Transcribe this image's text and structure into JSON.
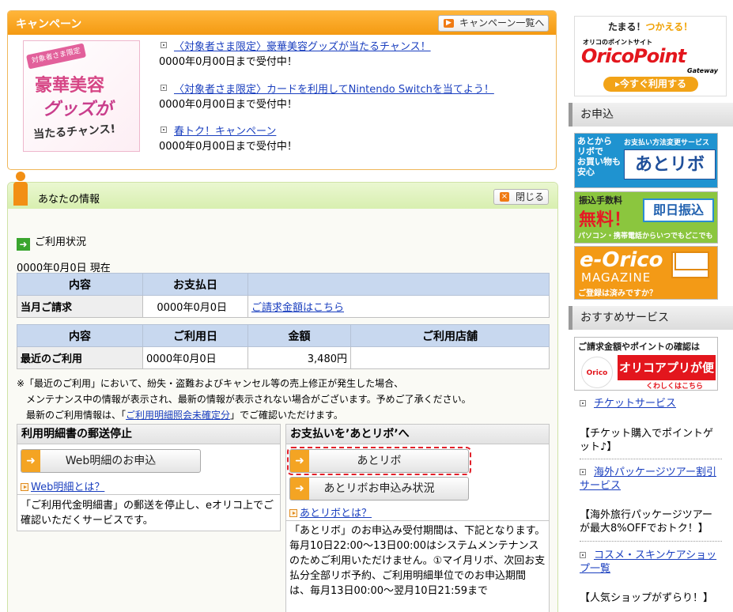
{
  "campaign": {
    "title": "キャンペーン",
    "all_button": "キャンペーン一覧へ",
    "banner": {
      "tag": "対象者さま限定",
      "line1": "豪華美容",
      "line2": "グッズが",
      "line3": "当たるチャンス!"
    },
    "items": [
      {
        "label": "〈対象者さま限定〉豪華美容グッズが当たるチャンス！",
        "date": "0000年0月00日まで受付中！"
      },
      {
        "label": "〈対象者さま限定〉カードを利用してNintendo Switchを当てよう！",
        "date": "0000年0月00日まで受付中！"
      },
      {
        "label": "春トク！キャンペーン",
        "date": "0000年0月00日まで受付中！"
      }
    ]
  },
  "info": {
    "title": "あなたの情報",
    "close": "閉じる",
    "usage_heading": "ご利用状況",
    "as_of": "0000年0月0日 現在",
    "table1": {
      "headers": [
        "内容",
        "お支払日",
        ""
      ],
      "row": {
        "label": "当月ご請求",
        "date": "0000年0月0日",
        "link": "ご請求金額はこちら"
      }
    },
    "table2": {
      "headers": [
        "内容",
        "ご利用日",
        "金額",
        "ご利用店舗"
      ],
      "row": {
        "label": "最近のご利用",
        "date": "0000年0月0日",
        "amount": "3,480円",
        "store": ""
      }
    },
    "note": {
      "line1": "※「最近のご利用」において、紛失・盗難およびキャンセル等の売上修正が発生した場合、",
      "line2": "メンテナンス中の情報が表示され、最新の情報が表示されない場合がございます。予めご了承ください。",
      "line3_pre": "最新のご利用情報は、「",
      "line3_link": "ご利用明細照会未確定分",
      "line3_post": "」でご確認いただけます。"
    },
    "box1": {
      "title": "利用明細書の郵送停止",
      "button": "Web明細のお申込",
      "link": "Web明細とは？",
      "text": "「ご利用代金明細書」の郵送を停止し、eオリコ上でご確認いただくサービスです。"
    },
    "box2": {
      "title": "お支払いを’あとリボ’へ",
      "button1": "あとリボ",
      "button2": "あとリボお申込み状況",
      "link": "あとリボとは？",
      "text": "「あとリボ」のお申込み受付期間は、下記となります。毎月10日22:00～13日00:00はシステムメンテナンスのためご利用いただけません。①マイ月リボ、次回お支払分全部リボ予約、ご利用明細単位でのお申込期間は、毎月13日00:00～翌月10日21:59まで"
    }
  },
  "sidebar": {
    "oricopoint": {
      "tagline_a": "たまる！",
      "tagline_b": "つかえる！",
      "small": "オリコのポイントサイト",
      "logo": "OricoPoint",
      "gateway": "Gateway",
      "button": "▸今すぐ利用する"
    },
    "section1": "お申込",
    "banner1": {
      "left": "あとから\nリボで\nお買い物も\n安心",
      "small": "お支払い方法変更サービス",
      "big": "あとリボ"
    },
    "banner2": {
      "top": "振込手数料",
      "big": "無料！",
      "box": "即日振込",
      "bottom": "パソコン・携帯電話からいつでもどこでも"
    },
    "banner3": {
      "logo": "e-Orico",
      "sub": "MAGAZINE",
      "bottom": "ご登録は済みですか？"
    },
    "section2": "おすすめサービス",
    "banner4": {
      "top": "ご請求金額やポイントの確認は",
      "logo": "Orico",
      "big": "オリコアプリが便利！",
      "bottom": "くわしくはこちら"
    },
    "list": [
      {
        "link": "チケットサービス",
        "desc": "【チケット購入でポイントゲット♪】"
      },
      {
        "link": "海外パッケージツアー割引サービス",
        "desc": "【海外旅行パッケージツアーが最大8%OFFでおトク！】"
      },
      {
        "link": "コスメ・スキンケアショップ一覧",
        "desc": "【人気ショップがずらり！】"
      }
    ]
  },
  "colors": {
    "campaign_header": "#f49a12",
    "info_header": "#d8efb0",
    "table_header": "#c8d8ef",
    "link": "#1a3fbf",
    "highlight_dash": "#e2202a"
  }
}
